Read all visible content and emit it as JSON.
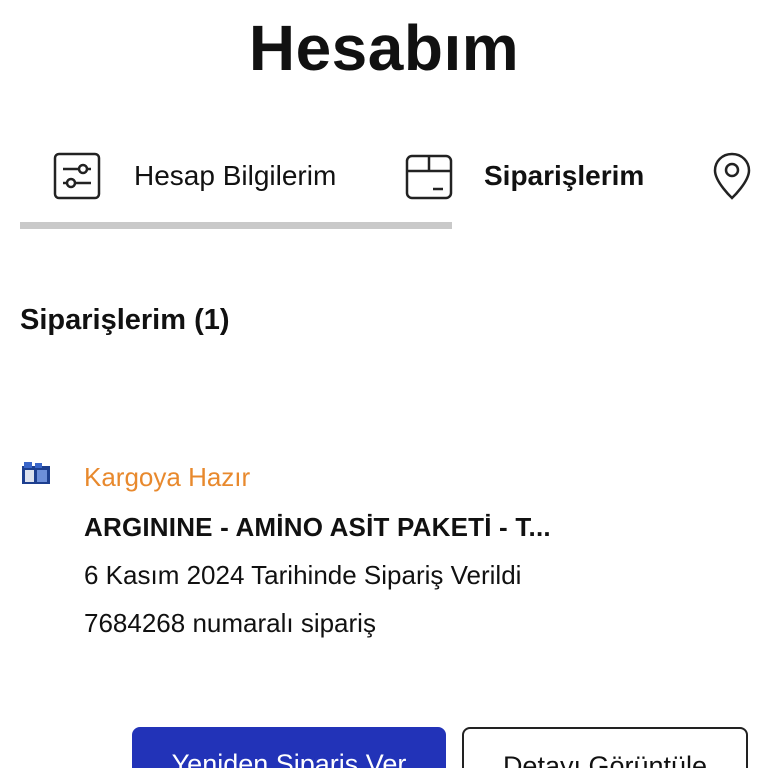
{
  "header": {
    "title": "Hesabım"
  },
  "tabs": [
    {
      "label": "Hesap Bilgilerim",
      "icon": "settings-sliders-icon",
      "active": false
    },
    {
      "label": "Siparişlerim",
      "icon": "package-box-icon",
      "active": true
    },
    {
      "label": "",
      "icon": "location-pin-icon",
      "active": false
    }
  ],
  "orders_section": {
    "title": "Siparişlerim (1)"
  },
  "order": {
    "thumbnail_icon": "product-thumbnail-icon",
    "status": "Kargoya Hazır",
    "status_color": "#e8892d",
    "product": "ARGININE - AMİNO ASİT PAKETİ - T...",
    "date_text": "6 Kasım 2024 Tarihinde Sipariş Verildi",
    "number_text": "7684268 numaralı sipariş"
  },
  "actions": {
    "reorder_label": "Yeniden Sipariş Ver",
    "details_label": "Detayı Görüntüle"
  },
  "colors": {
    "primary_button": "#2233b8",
    "tab_underline": "#c9c9c9"
  }
}
